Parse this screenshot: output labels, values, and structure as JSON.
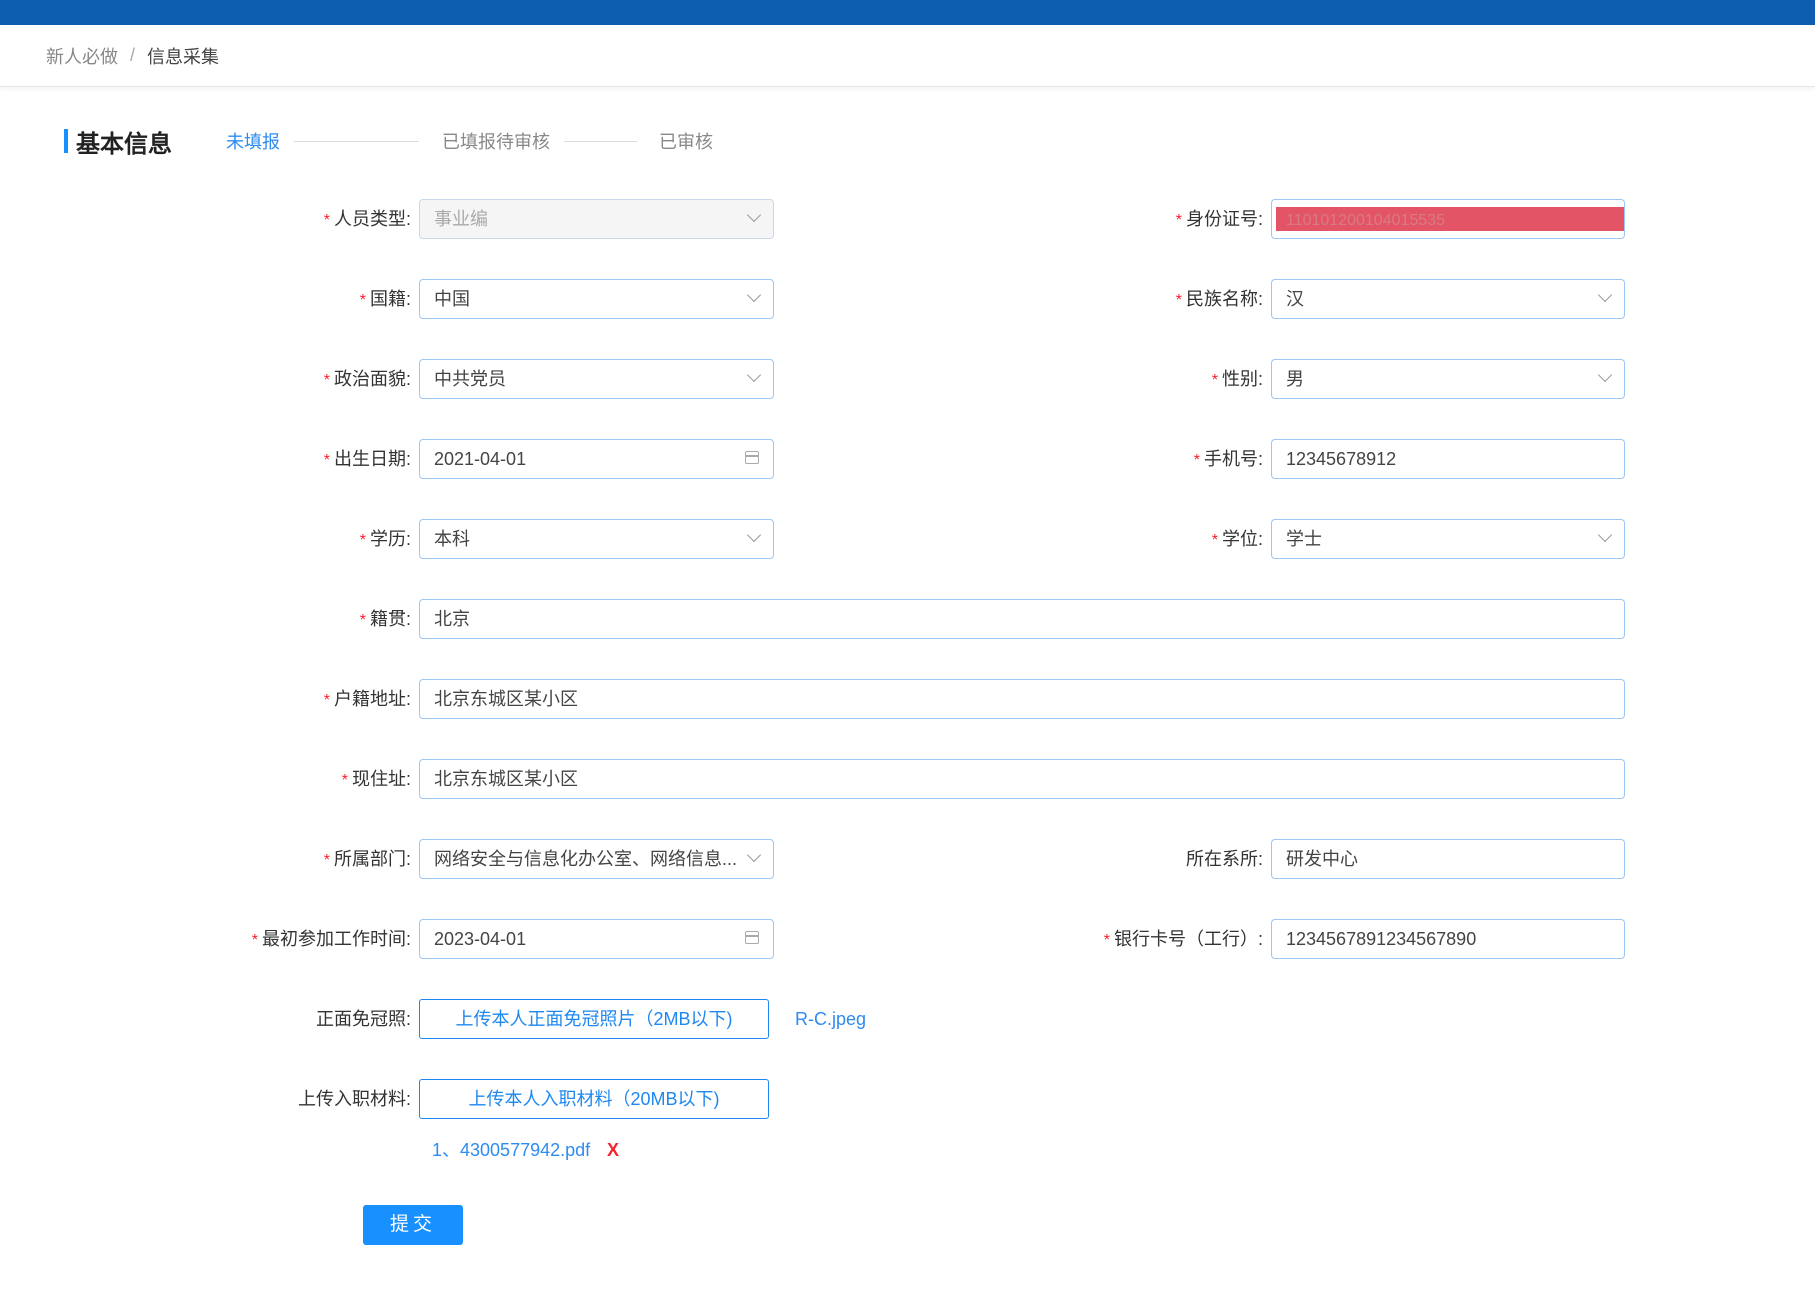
{
  "breadcrumb": {
    "item1": "新人必做",
    "separator": "/",
    "item2": "信息采集"
  },
  "section_title": "基本信息",
  "steps": [
    "未填报",
    "已填报待审核",
    "已审核"
  ],
  "form": {
    "person_type": {
      "label": "人员类型:",
      "value": "事业编"
    },
    "id_number": {
      "label": "身份证号:",
      "value": "110101200104015535"
    },
    "nationality": {
      "label": "国籍:",
      "value": "中国"
    },
    "ethnicity": {
      "label": "民族名称:",
      "value": "汉"
    },
    "political_status": {
      "label": "政治面貌:",
      "value": "中共党员"
    },
    "gender": {
      "label": "性别:",
      "value": "男"
    },
    "birth_date": {
      "label": "出生日期:",
      "value": "2021-04-01"
    },
    "phone": {
      "label": "手机号:",
      "value": "12345678912"
    },
    "education": {
      "label": "学历:",
      "value": "本科"
    },
    "degree": {
      "label": "学位:",
      "value": "学士"
    },
    "native_place": {
      "label": "籍贯:",
      "value": "北京"
    },
    "household_address": {
      "label": "户籍地址:",
      "value": "北京东城区某小区"
    },
    "current_address": {
      "label": "现住址:",
      "value": "北京东城区某小区"
    },
    "department": {
      "label": "所属部门:",
      "value": "网络安全与信息化办公室、网络信息..."
    },
    "faculty": {
      "label": "所在系所:",
      "value": "研发中心"
    },
    "first_work_date": {
      "label": "最初参加工作时间:",
      "value": "2023-04-01"
    },
    "bank_card": {
      "label": "银行卡号（工行）:",
      "value": "1234567891234567890"
    },
    "photo": {
      "label": "正面免冠照:",
      "button": "上传本人正面免冠照片（2MB以下)",
      "file": "R-C.jpeg"
    },
    "materials": {
      "label": "上传入职材料:",
      "button": "上传本人入职材料（20MB以下)",
      "file": "1、4300577942.pdf",
      "delete": "X"
    }
  },
  "submit_label": "提交",
  "colors": {
    "topbar": "#0c5fb0",
    "accent": "#1890ff",
    "required": "#f5222d"
  }
}
